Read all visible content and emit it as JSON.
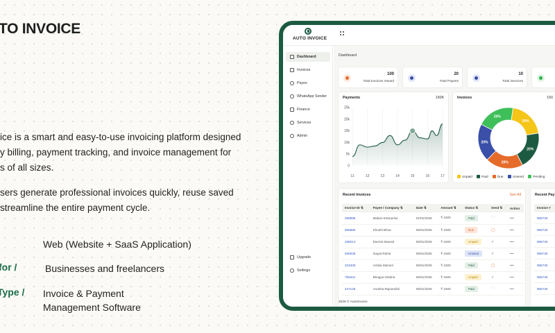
{
  "marketing": {
    "title": "TO INVOICE",
    "desc_lines": [
      "ice is a smart and easy-to-use invoicing platform designed",
      "y billing, payment tracking, and invoice management for",
      "s of all sizes."
    ],
    "desc2_lines": [
      "sers generate professional invoices quickly, reuse saved",
      "streamline the entire payment cycle."
    ],
    "meta": [
      {
        "key": "/",
        "value": "Web (Website + SaaS Application)"
      },
      {
        "key": "for /",
        "value": "Businesses and freelancers"
      },
      {
        "key": "Type /",
        "value": "Invoice & Payment",
        "value2": "Management Software"
      }
    ]
  },
  "app": {
    "logo_text": "AUTO INVOICE",
    "breadcrumb": "Dashboard",
    "footer": "2026 © AutoInvoice",
    "sidebar": {
      "items": [
        {
          "label": "Dashboard",
          "icon": "dashboard-icon"
        },
        {
          "label": "Invoices",
          "icon": "invoice-icon"
        },
        {
          "label": "Payes",
          "icon": "payee-icon"
        },
        {
          "label": "WhatsApp Sender",
          "icon": "whatsapp-icon"
        },
        {
          "label": "Finance",
          "icon": "finance-icon"
        },
        {
          "label": "Services",
          "icon": "services-icon"
        },
        {
          "label": "Admin",
          "icon": "admin-icon"
        }
      ],
      "bottom": [
        {
          "label": "Upgrade",
          "icon": "upgrade-icon"
        },
        {
          "label": "Settings",
          "icon": "settings-icon"
        }
      ]
    },
    "stats": [
      {
        "value": "100",
        "label": "Total Invoices Issued",
        "color": "#e56b2a",
        "bg": "#fde8dc"
      },
      {
        "value": "20",
        "label": "Total Payees",
        "color": "#3a4fa8",
        "bg": "#e1e6f8"
      },
      {
        "value": "10",
        "label": "Total Services",
        "color": "#3a4fa8",
        "bg": "#e1e6f8"
      },
      {
        "value": "",
        "label": "",
        "color": "#2fb34a",
        "bg": "#dff3e2"
      }
    ],
    "payments": {
      "title": "Payments",
      "total": "150K"
    },
    "invoices_donut": {
      "title": "Invoices",
      "total": "150",
      "legend": [
        {
          "label": "Unpaid",
          "color": "#f5c518"
        },
        {
          "label": "Paid",
          "color": "#1d5a42"
        },
        {
          "label": "Due",
          "color": "#e56b2a"
        },
        {
          "label": "Unsend",
          "color": "#3a4fa8"
        },
        {
          "label": "Pending",
          "color": "#3fbf5a"
        }
      ]
    },
    "recent_invoices": {
      "title": "Recent Invoices",
      "see_all": "See All",
      "columns": [
        "Invoice ID",
        "Payee / Company",
        "Date",
        "Amount",
        "Status",
        "Send",
        "Action"
      ],
      "rows": [
        {
          "id": "259595",
          "payee": "Makao Enterprise",
          "date": "01/01/2025",
          "amount": "₹ 1500",
          "status": "Paid",
          "send": "folder"
        },
        {
          "id": "586990",
          "payee": "Khushi Bhoa",
          "date": "05/01/2025",
          "amount": "₹ 1500",
          "status": "Due",
          "send": "circle"
        },
        {
          "id": "338214",
          "payee": "Darnini Mansol",
          "date": "06/01/2025",
          "amount": "₹ 1500",
          "status": "Unpaid",
          "send": "check"
        },
        {
          "id": "530036",
          "payee": "Inayat Rahul",
          "date": "06/01/2025",
          "amount": "₹ 1500",
          "status": "Unsend",
          "send": "check"
        },
        {
          "id": "224336",
          "payee": "Ambia Mansol",
          "date": "06/01/2025",
          "amount": "₹ 1500",
          "status": "Paid",
          "send": "circle"
        },
        {
          "id": "755341",
          "payee": "Bhagya Ostdria",
          "date": "06/01/2025",
          "amount": "₹ 1500",
          "status": "Unpaid",
          "send": "check"
        },
        {
          "id": "447125",
          "payee": "Anasha Rajnandini",
          "date": "06/01/2025",
          "amount": "₹ 1500",
          "status": "Paid",
          "send": "folder"
        }
      ]
    },
    "recent_payments": {
      "title": "Recent Pay",
      "column": "Invoice #",
      "rows": [
        "965740",
        "965740",
        "965740",
        "965740",
        "965740",
        "965740",
        "965740"
      ]
    }
  },
  "chart_data": [
    {
      "type": "area",
      "title": "Payments",
      "categories": [
        "11",
        "12",
        "13",
        "14",
        "15",
        "16",
        "17"
      ],
      "y_ticks": [
        "0",
        "5k",
        "10k",
        "15k",
        "20k",
        "25k"
      ],
      "ylim": [
        0,
        25000
      ],
      "values": [
        4000,
        9000,
        8000,
        8500,
        10000,
        13000,
        9000,
        11000,
        15000,
        12000,
        11500,
        15000,
        13000,
        18000
      ],
      "x_positions": [
        11,
        11.5,
        12,
        12.5,
        13,
        13.5,
        14,
        14.5,
        15,
        15.5,
        16,
        16.3,
        16.6,
        17
      ],
      "highlight": {
        "x": 15,
        "y": 15000
      },
      "color": "#1d5a42"
    },
    {
      "type": "pie",
      "title": "Invoices",
      "labels": [
        "Unpaid",
        "Paid",
        "Due",
        "Unsend",
        "Pending"
      ],
      "values": [
        20,
        20,
        20,
        20,
        20
      ],
      "slice_labels": [
        "20%",
        "20%",
        "20%",
        "20%",
        "20%"
      ],
      "colors": [
        "#f5c518",
        "#1d5a42",
        "#e56b2a",
        "#3a4fa8",
        "#3fbf5a"
      ]
    }
  ]
}
